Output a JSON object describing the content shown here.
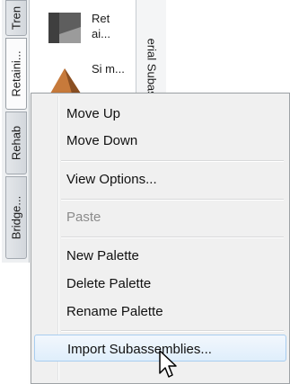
{
  "palette": {
    "left_tabs": [
      {
        "label": "Tren"
      },
      {
        "label": "Retaini..."
      },
      {
        "label": "Rehab"
      },
      {
        "label": "Bridge..."
      }
    ],
    "tools": [
      {
        "label": "Ret ai...",
        "icon": "retaining-wall-icon"
      },
      {
        "label": "Si m...",
        "icon": "slope-icon"
      }
    ],
    "right_tab": {
      "label": "erial Subasse"
    }
  },
  "context_menu": {
    "items": [
      {
        "label": "Move Up",
        "enabled": true
      },
      {
        "label": "Move Down",
        "enabled": true
      },
      {
        "label": "View Options...",
        "enabled": true
      },
      {
        "label": "Paste",
        "enabled": false
      },
      {
        "label": "New Palette",
        "enabled": true
      },
      {
        "label": "Delete Palette",
        "enabled": true
      },
      {
        "label": "Rename Palette",
        "enabled": true
      },
      {
        "label": "Import Subassemblies...",
        "enabled": true,
        "hovered": true
      }
    ]
  },
  "colors": {
    "menu_bg": "#f0f0f0",
    "hover_border": "#a8cdf0",
    "disabled_text": "#8b8b8b"
  }
}
